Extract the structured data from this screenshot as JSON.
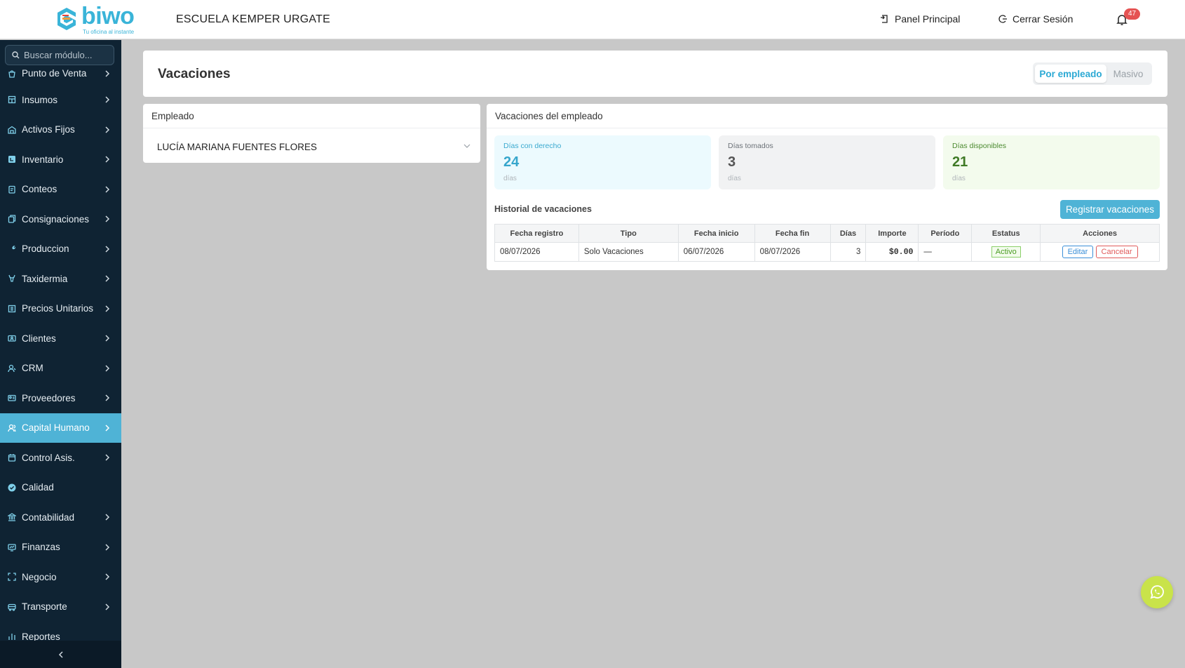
{
  "header": {
    "logo_text": "biwo",
    "logo_tagline": "Tu oficina al instante",
    "company": "ESCUELA KEMPER URGATE",
    "nav": [
      {
        "label": "Panel Principal",
        "icon": "panel-icon"
      },
      {
        "label": "Cerrar Sesión",
        "icon": "logout-icon"
      }
    ],
    "notifications_count": "47"
  },
  "sidebar": {
    "search_placeholder": "Buscar módulo...",
    "items": [
      {
        "label": "Punto de Venta",
        "icon": "shopping-bag-icon"
      },
      {
        "label": "Insumos",
        "icon": "warehouse-icon"
      },
      {
        "label": "Activos Fijos",
        "icon": "building-icon"
      },
      {
        "label": "Inventario",
        "icon": "inventory-icon"
      },
      {
        "label": "Conteos",
        "icon": "clipboard-icon"
      },
      {
        "label": "Consignaciones",
        "icon": "document-icon"
      },
      {
        "label": "Produccion",
        "icon": "wrench-icon"
      },
      {
        "label": "Taxidermia",
        "icon": "deer-icon"
      },
      {
        "label": "Precios Unitarios",
        "icon": "price-table-icon"
      },
      {
        "label": "Clientes",
        "icon": "client-card-icon"
      },
      {
        "label": "CRM",
        "icon": "crm-user-icon"
      },
      {
        "label": "Proveedores",
        "icon": "id-card-icon"
      },
      {
        "label": "Capital Humano",
        "icon": "people-icon"
      },
      {
        "label": "Control Asis.",
        "icon": "calendar-icon"
      },
      {
        "label": "Calidad",
        "icon": "check-badge-icon"
      },
      {
        "label": "Contabilidad",
        "icon": "bank-icon"
      },
      {
        "label": "Finanzas",
        "icon": "finance-icon"
      },
      {
        "label": "Negocio",
        "icon": "expand-icon"
      },
      {
        "label": "Transporte",
        "icon": "truck-icon"
      },
      {
        "label": "Reportes",
        "icon": "report-icon"
      }
    ],
    "active_item": "Capital Humano"
  },
  "page": {
    "title": "Vacaciones",
    "toggle": {
      "on": "Por empleado",
      "off": "Masivo"
    }
  },
  "employee_card": {
    "heading": "Empleado",
    "selected": "LUCÍA MARIANA FUENTES FLORES"
  },
  "vacation_card": {
    "heading": "Vacaciones del empleado",
    "stats": [
      {
        "label": "Días con derecho",
        "value": "24",
        "unit": "días"
      },
      {
        "label": "Días tomados",
        "value": "3",
        "unit": "días"
      },
      {
        "label": "Días disponibles",
        "value": "21",
        "unit": "días"
      }
    ],
    "history_title": "Historial de vacaciones",
    "register_button": "Registrar vacaciones",
    "table": {
      "columns": [
        "Fecha registro",
        "Tipo",
        "Fecha inicio",
        "Fecha fin",
        "Días",
        "Importe",
        "Período",
        "Estatus",
        "Acciones"
      ],
      "rows": [
        {
          "fecha_registro": "08/07/2026",
          "tipo": "Solo Vacaciones",
          "fecha_inicio": "06/07/2026",
          "fecha_fin": "08/07/2026",
          "dias": "3",
          "importe": "$0.00",
          "periodo": "—",
          "estatus": "Activo",
          "edit_label": "Editar",
          "cancel_label": "Cancelar"
        }
      ]
    }
  },
  "colors": {
    "accent": "#4fb3d6",
    "sidebar_bg": "#0f2333",
    "status_active": "#4a9c22",
    "danger": "#e05a5a",
    "whatsapp_button": "#c9e34a"
  }
}
